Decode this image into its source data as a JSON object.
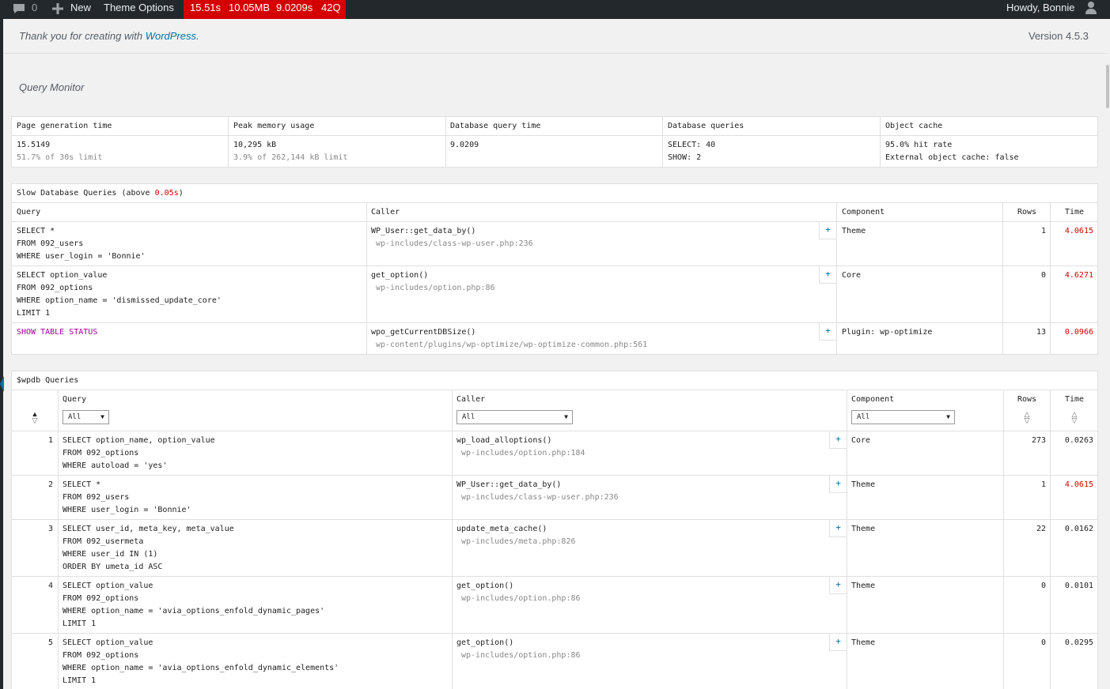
{
  "adminbar": {
    "comments_count": "0",
    "new_label": "New",
    "theme_options": "Theme Options",
    "qm_time": "15.51s",
    "qm_memory": "10.05MB",
    "qm_dbtime": "9.0209s",
    "qm_queries": "42Q",
    "howdy": "Howdy, Bonnie"
  },
  "footer": {
    "thanks_prefix": "Thank you for creating with ",
    "thanks_link": "WordPress",
    "thanks_suffix": ".",
    "version": "Version 4.5.3"
  },
  "qm": {
    "title": "Query Monitor",
    "overview": [
      {
        "label": "Page generation time",
        "value": "15.5149",
        "sub": "51.7% of 30s limit"
      },
      {
        "label": "Peak memory usage",
        "value": "10,295 kB",
        "sub": "3.9% of 262,144 kB limit"
      },
      {
        "label": "Database query time",
        "value": "9.0209",
        "sub": ""
      },
      {
        "label": "Database queries",
        "value": "SELECT: 40",
        "sub": "SHOW: 2"
      },
      {
        "label": "Object cache",
        "value": "95.0% hit rate",
        "sub": "External object cache: false"
      }
    ],
    "slow": {
      "title_prefix": "Slow Database Queries (above ",
      "title_threshold": "0.05s",
      "title_suffix": ")",
      "headers": {
        "query": "Query",
        "caller": "Caller",
        "component": "Component",
        "rows": "Rows",
        "time": "Time"
      },
      "rows": [
        {
          "query": "SELECT *\nFROM 092_users\nWHERE user_login = 'Bonnie'",
          "caller": "WP_User::get_data_by()",
          "file": "wp-includes/class-wp-user.php:236",
          "component": "Theme",
          "rows": "1",
          "time": "4.0615"
        },
        {
          "query": "SELECT option_value\nFROM 092_options\nWHERE option_name = 'dismissed_update_core'\nLIMIT 1",
          "caller": "get_option()",
          "file": "wp-includes/option.php:86",
          "component": "Core",
          "rows": "0",
          "time": "4.6271"
        },
        {
          "query": "SHOW TABLE STATUS",
          "caller": "wpo_getCurrentDBSize()",
          "file": "wp-content/plugins/wp-optimize/wp-optimize-common.php:561",
          "component": "Plugin: wp-optimize",
          "rows": "13",
          "time": "0.0966"
        }
      ]
    },
    "wpdb": {
      "title": "$wpdb Queries",
      "headers": {
        "query": "Query",
        "caller": "Caller",
        "component": "Component",
        "rows": "Rows",
        "time": "Time"
      },
      "filters": {
        "query": "All",
        "caller": "All",
        "component": "All"
      },
      "rows": [
        {
          "num": "1",
          "query": "SELECT option_name, option_value\nFROM 092_options\nWHERE autoload = 'yes'",
          "caller": "wp_load_alloptions()",
          "file": "wp-includes/option.php:184",
          "component": "Core",
          "rows": "273",
          "time": "0.0263"
        },
        {
          "num": "2",
          "query": "SELECT *\nFROM 092_users\nWHERE user_login = 'Bonnie'",
          "caller": "WP_User::get_data_by()",
          "file": "wp-includes/class-wp-user.php:236",
          "component": "Theme",
          "rows": "1",
          "time": "4.0615"
        },
        {
          "num": "3",
          "query": "SELECT user_id, meta_key, meta_value\nFROM 092_usermeta\nWHERE user_id IN (1)\nORDER BY umeta_id ASC",
          "caller": "update_meta_cache()",
          "file": "wp-includes/meta.php:826",
          "component": "Theme",
          "rows": "22",
          "time": "0.0162"
        },
        {
          "num": "4",
          "query": "SELECT option_value\nFROM 092_options\nWHERE option_name = 'avia_options_enfold_dynamic_pages'\nLIMIT 1",
          "caller": "get_option()",
          "file": "wp-includes/option.php:86",
          "component": "Theme",
          "rows": "0",
          "time": "0.0101"
        },
        {
          "num": "5",
          "query": "SELECT option_value\nFROM 092_options\nWHERE option_name = 'avia_options_enfold_dynamic_elements'\nLIMIT 1",
          "caller": "get_option()",
          "file": "wp-includes/option.php:86",
          "component": "Theme",
          "rows": "0",
          "time": "0.0295"
        }
      ]
    },
    "colors": {
      "red": "#d40000",
      "link": "#0073aa",
      "adminbar": "#23282d",
      "purple": "#a0009c"
    }
  }
}
